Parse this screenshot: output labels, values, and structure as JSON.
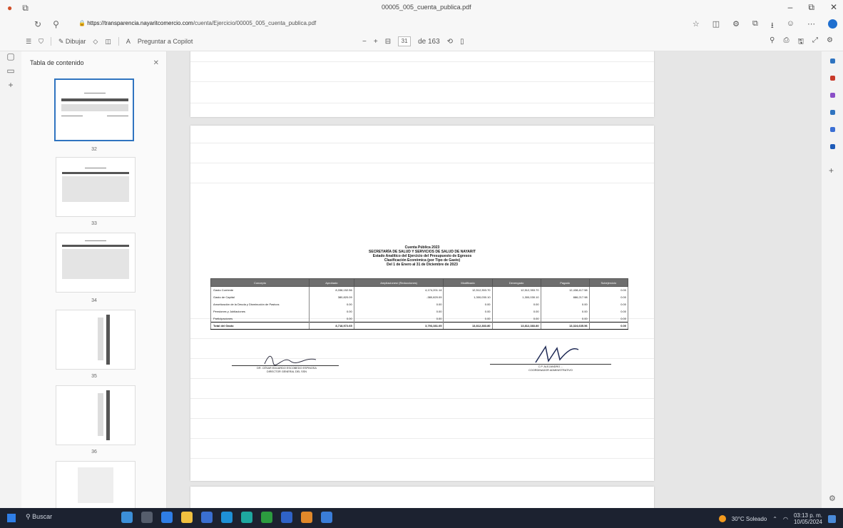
{
  "window": {
    "title": "00005_005_cuenta_publica.pdf",
    "controls": [
      "–",
      "⧉",
      "✕"
    ]
  },
  "address": {
    "url_host": "https://transparencia.nayaritcomercio.com",
    "url_path": "/cuenta/Ejercicio/00005_005_cuenta_publica.pdf"
  },
  "pdf_toolbar": {
    "draw_label": "Dibujar",
    "read_aloud_label": "Preguntar a Copilot",
    "page_current": "31",
    "page_total": "de 163",
    "zoom_out": "−",
    "zoom_in": "+"
  },
  "sidebar": {
    "title": "Tabla de contenido",
    "close": "✕",
    "page_numbers": [
      "32",
      "33",
      "34",
      "35",
      "36"
    ]
  },
  "document": {
    "title_lines": [
      "Cuenta Pública 2023",
      "SECRETARÍA DE SALUD Y SERVICIOS DE SALUD DE NAYARIT",
      "Estado Analítico del Ejercicio del Presupuesto de Egresos",
      "Clasificación Económica (por Tipo de Gasto)",
      "Del 1 de Enero al 31 de Diciembre de 2023"
    ],
    "table": {
      "headers": [
        "Concepto",
        "Aprobado",
        "Ampliaciones/ (Reducciones)",
        "Modificado",
        "Devengado",
        "Pagado",
        "Subejercicio"
      ],
      "rows": [
        [
          "Gasto Corriente",
          "8,338,152.56",
          "4,174,201.14",
          "12,512,353.70",
          "12,512,353.70",
          "12,438,417.58",
          "0.00"
        ],
        [
          "Gasto de Capital",
          "380,820.09",
          "-380,820.09",
          "1,300,030.10",
          "1,300,030.10",
          "886,217.98",
          "0.00"
        ],
        [
          "Amortización de la Deuda y Disminución de Pasivos",
          "0.00",
          "0.00",
          "0.00",
          "0.00",
          "0.00",
          "0.00"
        ],
        [
          "Pensiones y Jubilaciones",
          "0.00",
          "0.00",
          "0.00",
          "0.00",
          "0.00",
          "0.00"
        ],
        [
          "Participaciones",
          "0.00",
          "0.00",
          "0.00",
          "0.00",
          "0.00",
          "0.00"
        ]
      ],
      "total": [
        "Total del Gasto",
        "8,718,972.65",
        "3,793,381.05",
        "13,812,383.80",
        "13,812,383.80",
        "13,324,635.56",
        "0.00"
      ]
    },
    "signatures": [
      {
        "name": "DR. CÉSAR EDUARDO ESCOBEDO ESPINOSA",
        "role": "DIRECTOR GENERAL DEL SSN"
      },
      {
        "name": "C.P. ALEJANDRO ...",
        "role": "COORDINADOR ADMINISTRATIVO"
      }
    ]
  },
  "taskbar": {
    "search_placeholder": "Buscar",
    "weather": "30°C Soleado",
    "time": "03:13 p. m.",
    "date": "10/05/2024"
  },
  "colors": {
    "accent": "#2f74c0",
    "table_header": "#6e6e6e",
    "taskbar": "#1c2230"
  }
}
